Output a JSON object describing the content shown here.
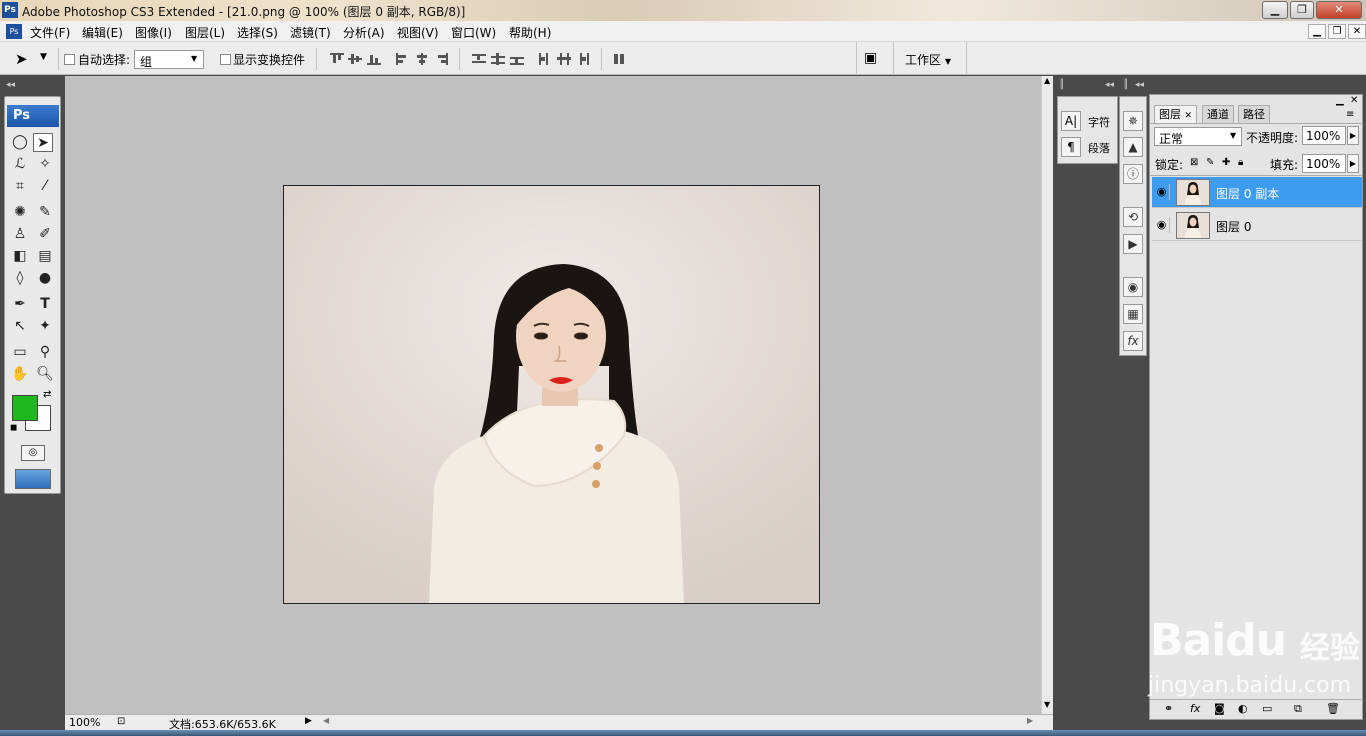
{
  "window": {
    "title": "Adobe Photoshop CS3 Extended - [21.0.png @ 100% (图层 0 副本, RGB/8)]",
    "app_icon": "Ps"
  },
  "menu": [
    "文件(F)",
    "编辑(E)",
    "图像(I)",
    "图层(L)",
    "选择(S)",
    "滤镜(T)",
    "分析(A)",
    "视图(V)",
    "窗口(W)",
    "帮助(H)"
  ],
  "options": {
    "auto_select_label": "自动选择:",
    "auto_select_value": "组",
    "show_transform_label": "显示变换控件",
    "workspace_label": "工作区"
  },
  "toolbox": {
    "logo": "Ps",
    "foreground_color": "#1fb81f",
    "background_color": "#ffffff"
  },
  "char_panel": {
    "character_label": "字符",
    "paragraph_label": "段落"
  },
  "layers_panel": {
    "tabs": [
      "图层",
      "通道",
      "路径"
    ],
    "blend_mode": "正常",
    "opacity_label": "不透明度:",
    "opacity_value": "100%",
    "lock_label": "锁定:",
    "fill_label": "填充:",
    "fill_value": "100%",
    "layers": [
      {
        "name": "图层 0 副本",
        "selected": true
      },
      {
        "name": "图层 0",
        "selected": false
      }
    ]
  },
  "status": {
    "zoom": "100%",
    "doc": "文档:653.6K/653.6K"
  },
  "watermark": {
    "brand": "Baidu",
    "brand_cn": "经验",
    "url": "jingyan.baidu.com"
  },
  "colors": {
    "selection": "#3d9bf0",
    "canvas_bg": "#c0c0c0",
    "workspace_dark": "#4a4a4a"
  }
}
